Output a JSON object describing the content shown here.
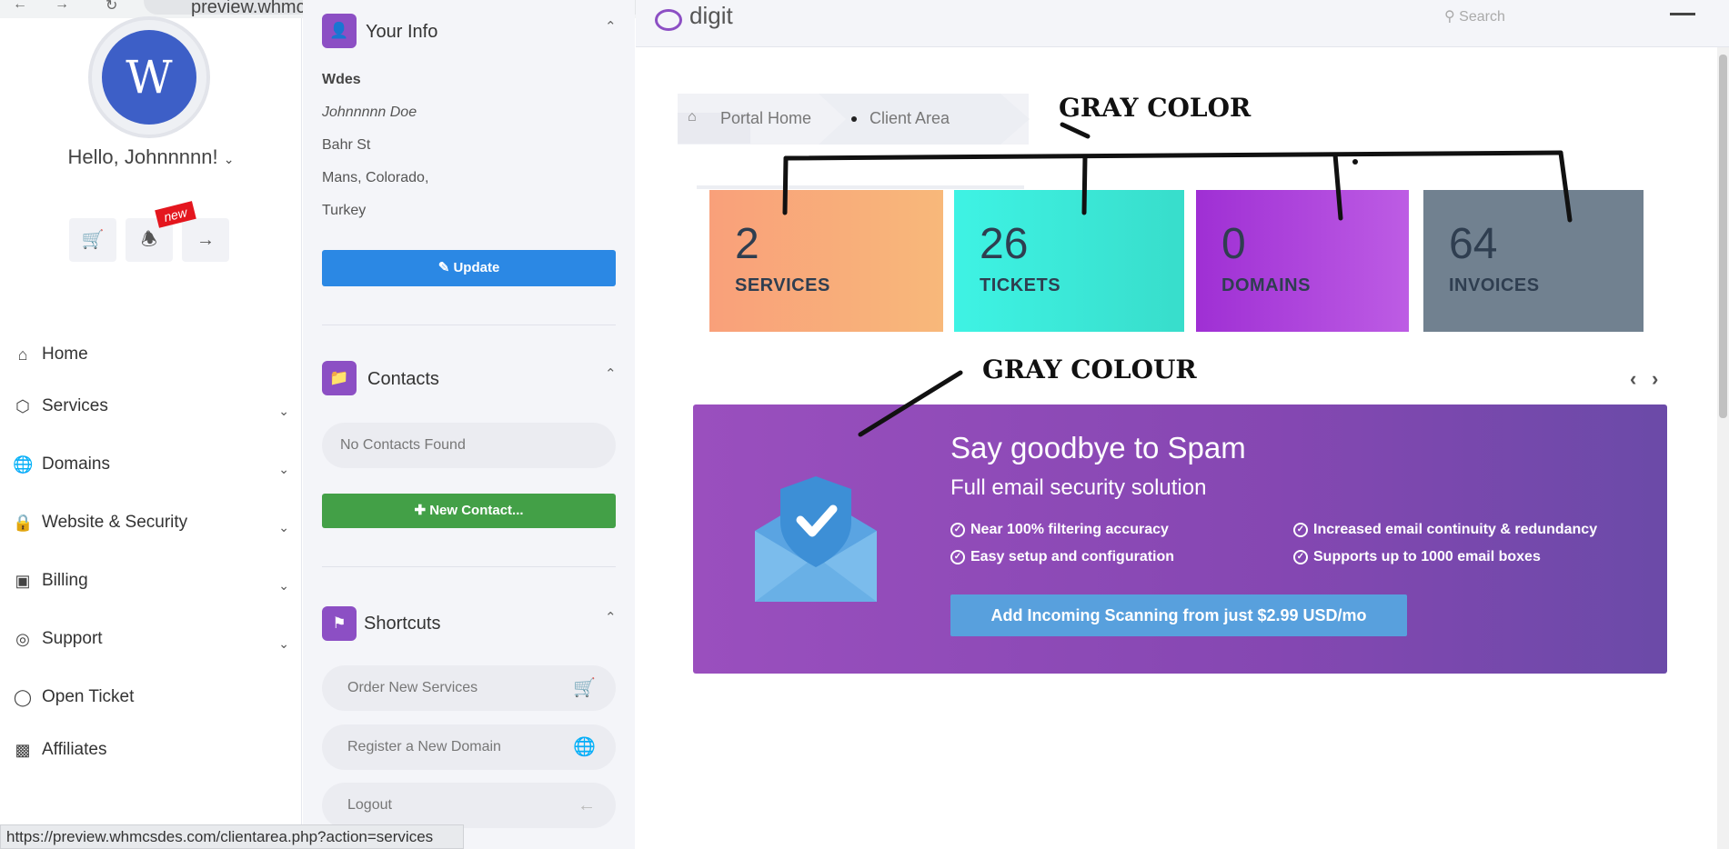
{
  "browser": {
    "url": "preview.whmcsdes.com/clientarea.php"
  },
  "sidebar": {
    "avatar_letter": "W",
    "greeting": "Hello, Johnnnnn!",
    "new_badge": "new",
    "items": [
      {
        "label": "Home",
        "icon": "home-icon",
        "has_chevron": false
      },
      {
        "label": "Services",
        "icon": "box-icon",
        "has_chevron": true
      },
      {
        "label": "Domains",
        "icon": "globe-icon",
        "has_chevron": true
      },
      {
        "label": "Website & Security",
        "icon": "lock-icon",
        "has_chevron": true
      },
      {
        "label": "Billing",
        "icon": "credit-card-icon",
        "has_chevron": true
      },
      {
        "label": "Support",
        "icon": "lifebuoy-icon",
        "has_chevron": true
      },
      {
        "label": "Open Ticket",
        "icon": "tag-icon",
        "has_chevron": false
      },
      {
        "label": "Affiliates",
        "icon": "money-icon",
        "has_chevron": false
      }
    ]
  },
  "your_info": {
    "title": "Your Info",
    "company": "Wdes",
    "name": "Johnnnnn Doe",
    "street": "Bahr St",
    "city": "Mans, Colorado,",
    "country": "Turkey",
    "update_label": "Update"
  },
  "contacts": {
    "title": "Contacts",
    "empty_text": "No Contacts Found",
    "new_label": "New Contact..."
  },
  "shortcuts": {
    "title": "Shortcuts",
    "items": [
      {
        "label": "Order New Services",
        "icon": "cart-icon"
      },
      {
        "label": "Register a New Domain",
        "icon": "globe-icon"
      },
      {
        "label": "Logout",
        "icon": "arrow-left-icon"
      }
    ]
  },
  "header": {
    "logo_text": "digit",
    "search_placeholder": "Search"
  },
  "breadcrumb": {
    "items": [
      "Portal Home",
      "Client Area"
    ]
  },
  "tiles": [
    {
      "number": "2",
      "label": "SERVICES",
      "color": "#f9a07a"
    },
    {
      "number": "26",
      "label": "TICKETS",
      "color": "#3ee8d6"
    },
    {
      "number": "0",
      "label": "DOMAINS",
      "color": "#a63fd6"
    },
    {
      "number": "64",
      "label": "INVOICES",
      "color": "#718190"
    }
  ],
  "promo": {
    "title": "Say goodbye to Spam",
    "subtitle": "Full email security solution",
    "features": [
      "Near 100% filtering accuracy",
      "Increased email continuity & redundancy",
      "Easy setup and configuration",
      "Supports up to 1000 email boxes"
    ],
    "cta": "Add Incoming Scanning from just $2.99 USD/mo"
  },
  "annotations": {
    "top": "GRAY COLOR",
    "middle": "GRAY COLOUR"
  },
  "status_bar": {
    "url": "https://preview.whmcsdes.com/clientarea.php?action=services"
  }
}
